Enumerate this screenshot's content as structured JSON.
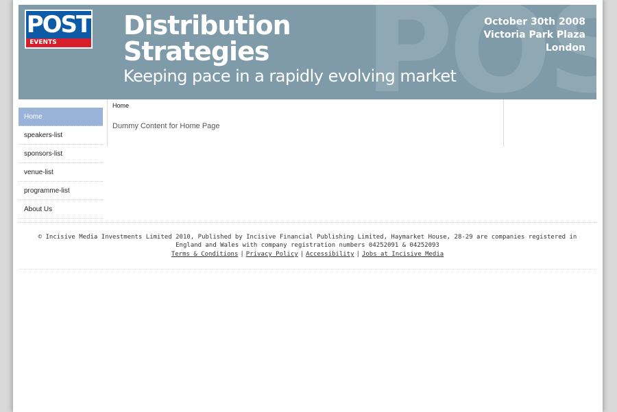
{
  "banner": {
    "logo_top": "POST",
    "logo_bottom": "EVENTS",
    "watermark": "POST",
    "title_line1": "Distribution",
    "title_line2": "Strategies",
    "tagline": "Keeping pace in a rapidly evolving market",
    "date": "October 30th 2008",
    "venue": "Victoria Park Plaza",
    "city": "London"
  },
  "nav": {
    "items": [
      "Home",
      "speakers-list",
      "sponsors-list",
      "venue-list",
      "programme-list",
      "About Us"
    ]
  },
  "content": {
    "breadcrumb": "Home",
    "text": "Dummy Content for Home Page"
  },
  "footer": {
    "copyright": "© Incisive Media Investments Limited 2010, Published by Incisive Financial Publishing Limited, Haymarket House, 28-29 are companies registered in England and Wales with company registration numbers 04252091 & 04252093",
    "links": [
      "Terms & Conditions",
      "Privacy Policy",
      "Accessibility",
      "Jobs at Incisive Media"
    ],
    "separator": "|"
  },
  "colors": {
    "banner_bg": "#7f9aa8",
    "nav_active": "#9ab3d9",
    "logo_blue": "#0d5aa6",
    "logo_red": "#d51f2b"
  }
}
